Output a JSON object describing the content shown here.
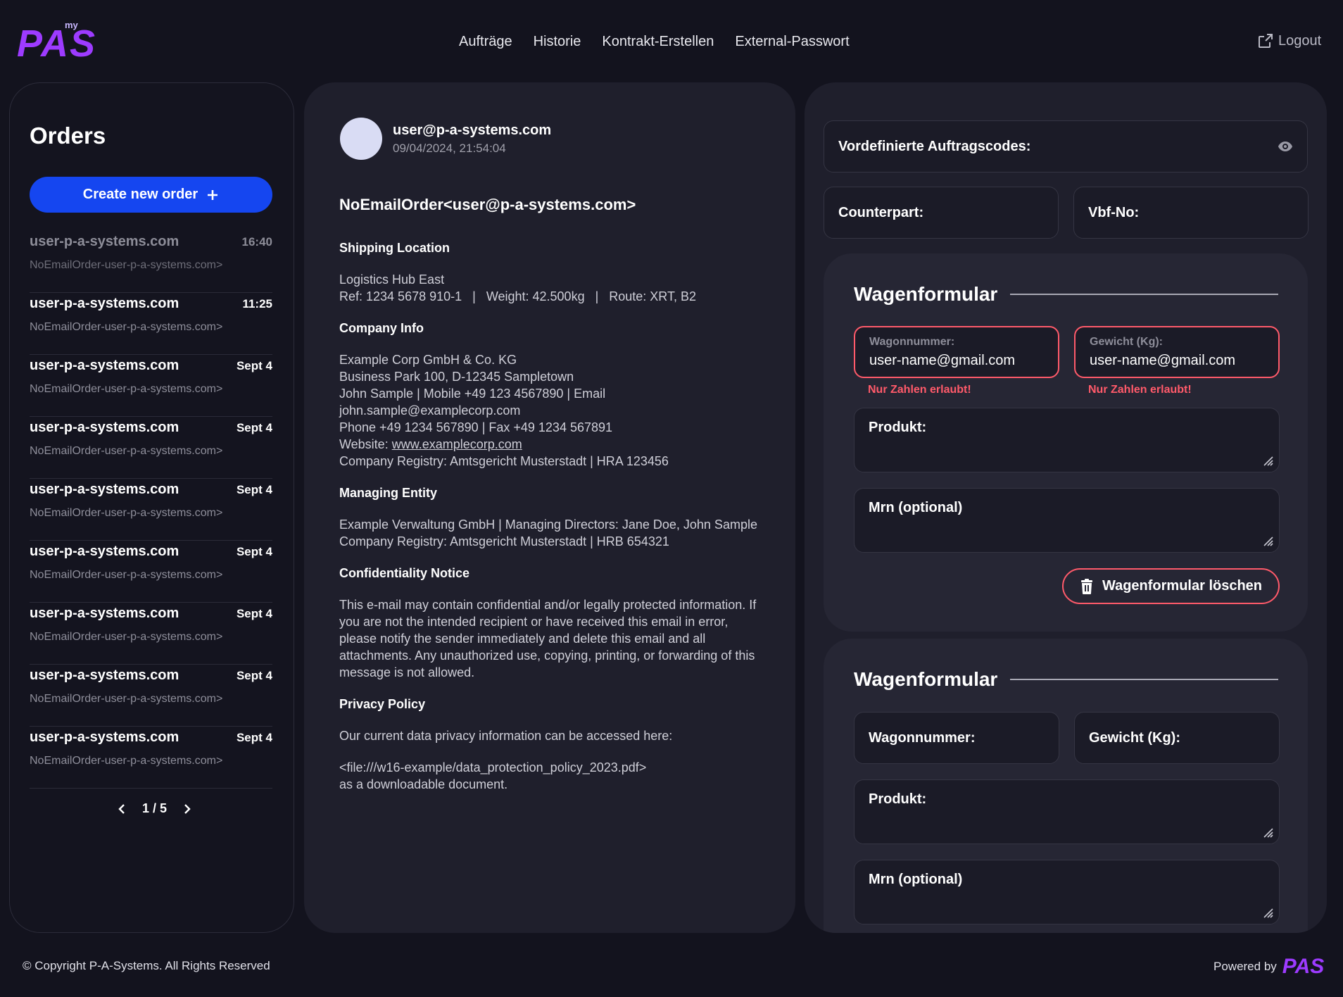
{
  "brand": {
    "logo_main": "PAS",
    "logo_sup": "my"
  },
  "nav": [
    "Aufträge",
    "Historie",
    "Kontrakt-Erstellen",
    "External-Passwort"
  ],
  "header": {
    "logout": "Logout"
  },
  "orders": {
    "title": "Orders",
    "create_label": "Create new order",
    "items": [
      {
        "from": "user-p-a-systems.com",
        "time": "16:40",
        "subject": "NoEmailOrder-user-p-a-systems.com>"
      },
      {
        "from": "user-p-a-systems.com",
        "time": "11:25",
        "subject": "NoEmailOrder-user-p-a-systems.com>"
      },
      {
        "from": "user-p-a-systems.com",
        "time": "Sept 4",
        "subject": "NoEmailOrder-user-p-a-systems.com>"
      },
      {
        "from": "user-p-a-systems.com",
        "time": "Sept 4",
        "subject": "NoEmailOrder-user-p-a-systems.com>"
      },
      {
        "from": "user-p-a-systems.com",
        "time": "Sept 4",
        "subject": "NoEmailOrder-user-p-a-systems.com>"
      },
      {
        "from": "user-p-a-systems.com",
        "time": "Sept 4",
        "subject": "NoEmailOrder-user-p-a-systems.com>"
      },
      {
        "from": "user-p-a-systems.com",
        "time": "Sept 4",
        "subject": "NoEmailOrder-user-p-a-systems.com>"
      },
      {
        "from": "user-p-a-systems.com",
        "time": "Sept 4",
        "subject": "NoEmailOrder-user-p-a-systems.com>"
      },
      {
        "from": "user-p-a-systems.com",
        "time": "Sept 4",
        "subject": "NoEmailOrder-user-p-a-systems.com>"
      }
    ],
    "pager": "1 / 5"
  },
  "email": {
    "sender": "user@p-a-systems.com",
    "date": "09/04/2024, 21:54:04",
    "subject": "NoEmailOrder<user@p-a-systems.com>",
    "shipping_title": "Shipping Location",
    "shipping_line1": "Logistics Hub East",
    "shipping_line2": "Ref: 1234 5678 910-1   |   Weight: 42.500kg   |   Route: XRT, B2",
    "company_title": "Company Info",
    "company_line1": "Example Corp GmbH & Co. KG",
    "company_line2": "Business Park 100, D-12345 Sampletown",
    "company_line3": "John Sample | Mobile +49 123 4567890 | Email john.sample@examplecorp.com",
    "company_line4": "Phone +49 1234 567890 | Fax +49 1234 567891",
    "company_website_label": "Website: ",
    "company_website": "www.examplecorp.com",
    "company_line6": "Company Registry: Amtsgericht Musterstadt | HRA 123456",
    "managing_title": "Managing Entity",
    "managing_line1": "Example Verwaltung GmbH | Managing Directors: Jane Doe, John Sample",
    "managing_line2": "Company Registry: Amtsgericht Musterstadt | HRB 654321",
    "conf_title": "Confidentiality Notice",
    "conf_text": "This e-mail may contain confidential and/or legally protected information. If you are not the intended recipient or have received this email in error, please notify the sender immediately and delete this email and all attachments. Any unauthorized use, copying, printing, or forwarding of this message is not allowed.",
    "privacy_title": "Privacy Policy",
    "privacy_text": "Our current data privacy information can be accessed here:",
    "privacy_link": "<file:///w16-example/data_protection_policy_2023.pdf>",
    "privacy_tail": "as a downloadable document."
  },
  "form": {
    "codes_label": "Vordefinierte Auftragscodes:",
    "counterpart_label": "Counterpart:",
    "vbf_label": "Vbf-No:",
    "wagon1": {
      "title": "Wagenformular",
      "wagon_label": "Wagonnummer:",
      "wagon_value": "user-name@gmail.com",
      "weight_label": "Gewicht (Kg):",
      "weight_value": "user-name@gmail.com",
      "error": "Nur Zahlen erlaubt!",
      "product_label": "Produkt:",
      "mrn_label": "Mrn (optional)",
      "delete_label": "Wagenformular löschen"
    },
    "wagon2": {
      "title": "Wagenformular",
      "wagon_label": "Wagonnummer:",
      "weight_label": "Gewicht (Kg):",
      "product_label": "Produkt:",
      "mrn_label": "Mrn (optional)"
    }
  },
  "footer": {
    "copyright": "© Copyright P-A-Systems. All Rights Reserved",
    "powered": "Powered by",
    "powered_logo": "PAS"
  },
  "colors": {
    "accent": "#1546f0",
    "error": "#ff5a6a",
    "brand": "#9d3bff"
  }
}
